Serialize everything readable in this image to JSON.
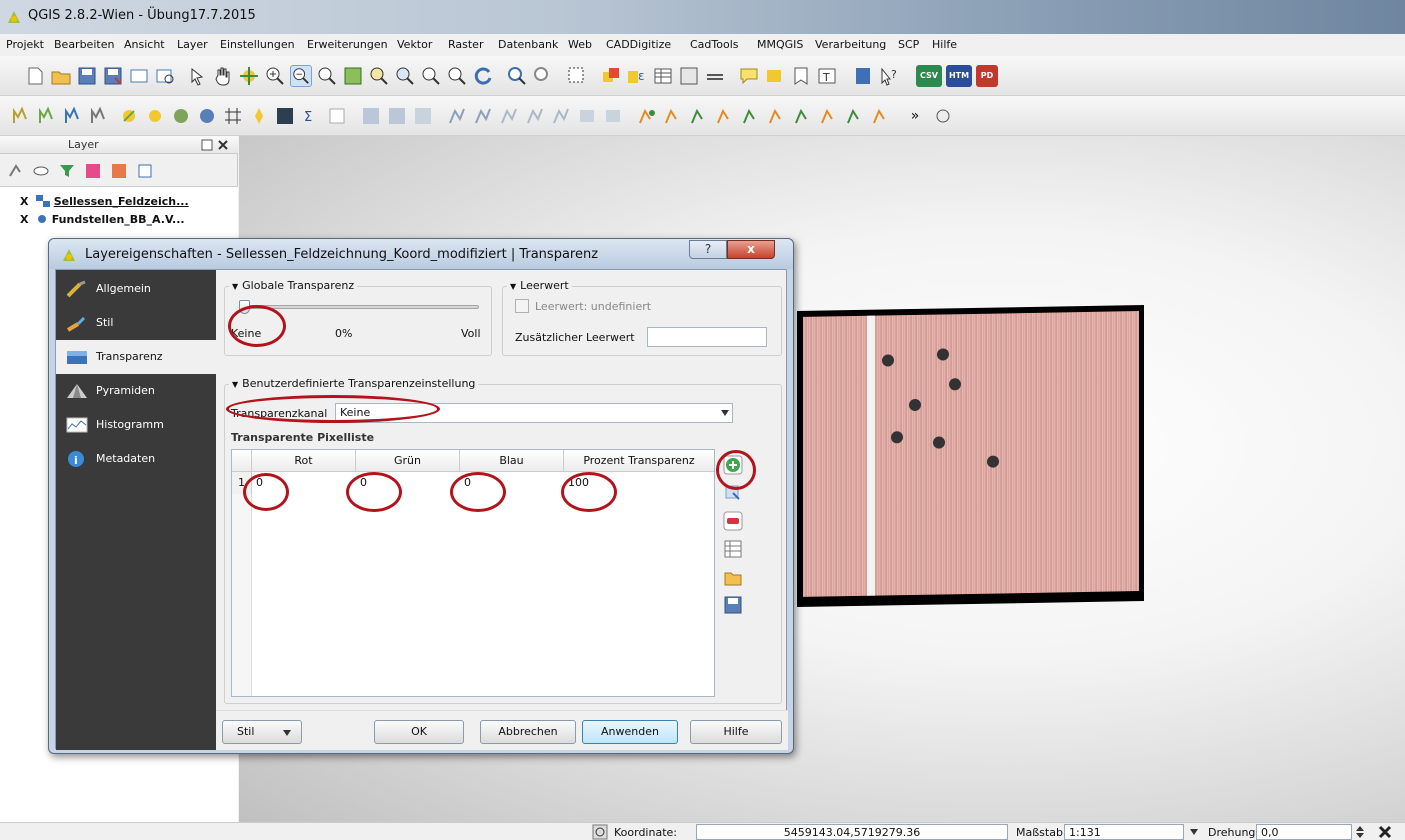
{
  "app": {
    "window_title": "QGIS 2.8.2-Wien - Übung17.7.2015"
  },
  "menu": [
    "Projekt",
    "Bearbeiten",
    "Ansicht",
    "Layer",
    "Einstellungen",
    "Erweiterungen",
    "Vektor",
    "Raster",
    "Datenbank",
    "Web",
    "CADDigitize",
    "CadTools",
    "MMQGIS",
    "Verarbeitung",
    "SCP",
    "Hilfe"
  ],
  "toolbar": {
    "csv_label": "CSV",
    "htm_label": "HTM",
    "pd_label": "PD",
    "more_label": "»"
  },
  "layer_panel": {
    "title": "Layer",
    "layers": [
      {
        "name": "Sellessen_Feldzeich...",
        "checked": "X"
      },
      {
        "name": "Fundstellen_BB_A.V...",
        "checked": "X"
      }
    ]
  },
  "dialog": {
    "title": "Layereigenschaften - Sellessen_Feldzeichnung_Koord_modifiziert | Transparenz",
    "help_glyph": "?",
    "close_glyph": "x",
    "nav": [
      {
        "label": "Allgemein",
        "icon": "general-icon"
      },
      {
        "label": "Stil",
        "icon": "style-brush-icon"
      },
      {
        "label": "Transparenz",
        "icon": "transparency-icon",
        "selected": true
      },
      {
        "label": "Pyramiden",
        "icon": "pyramid-icon"
      },
      {
        "label": "Histogramm",
        "icon": "histogram-icon"
      },
      {
        "label": "Metadaten",
        "icon": "info-icon"
      }
    ],
    "global": {
      "title": "Globale Transparenz",
      "min_label": "Keine",
      "value_label": "0%",
      "max_label": "Voll",
      "value": 0
    },
    "nodata": {
      "title": "Leerwert",
      "checkbox_label": "Leerwert:  undefiniert",
      "extra_label": "Zusätzlicher Leerwert",
      "extra_value": ""
    },
    "custom": {
      "title": "Benutzerdefinierte Transparenzeinstellung",
      "channel_label": "Transparenzkanal",
      "channel_value": "Keine",
      "list_label": "Transparente Pixelliste",
      "columns": [
        "Rot",
        "Grün",
        "Blau",
        "Prozent Transparenz"
      ],
      "rows": [
        {
          "index": "1",
          "red": "0",
          "green": "0",
          "blue": "0",
          "percent": "100"
        }
      ]
    },
    "buttons": {
      "stil": "Stil",
      "ok": "OK",
      "cancel": "Abbrechen",
      "apply": "Anwenden",
      "help": "Hilfe"
    }
  },
  "statusbar": {
    "coord_label": "Koordinate:",
    "coord_value": "5459143.04,5719279.36",
    "scale_label": "Maßstab",
    "scale_value": "1:131",
    "rotation_label": "Drehung:",
    "rotation_value": "0,0"
  },
  "colors": {
    "highlight_circle": "#b3141b",
    "dialog_nav_bg": "#3a3a3a"
  }
}
